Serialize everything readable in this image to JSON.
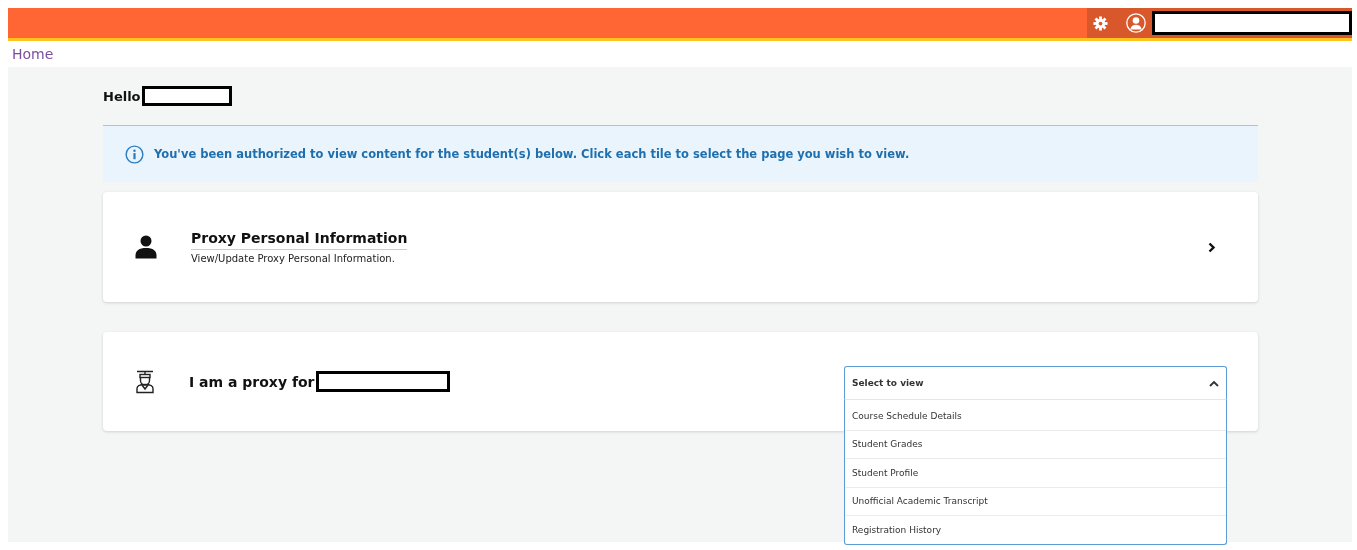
{
  "breadcrumb": {
    "label": "Home"
  },
  "greeting": {
    "label": "Hello"
  },
  "notice": {
    "text": "You've been authorized to view content for the student(s) below. Click each tile to select the page you wish to view."
  },
  "tiles": [
    {
      "kind": "link",
      "title": "Proxy Personal Information",
      "description": "View/Update Proxy Personal Information."
    },
    {
      "kind": "select",
      "title": "I am a proxy for",
      "dropdown": {
        "placeholder": "Select to view",
        "expanded": true,
        "options": [
          {
            "label": "Course Schedule Details",
            "selected": false
          },
          {
            "label": "Student Grades",
            "selected": false
          },
          {
            "label": "Student Profile",
            "selected": false
          },
          {
            "label": "Unofficial Academic Transcript",
            "selected": false
          },
          {
            "label": "Registration History",
            "selected": false
          }
        ]
      }
    }
  ]
}
